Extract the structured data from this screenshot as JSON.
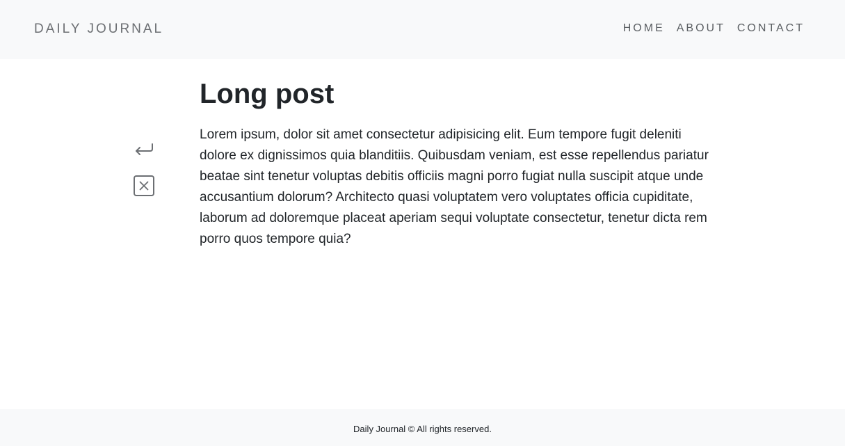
{
  "navbar": {
    "brand": "DAILY JOURNAL",
    "links": [
      {
        "label": "HOME"
      },
      {
        "label": "ABOUT"
      },
      {
        "label": "CONTACT"
      }
    ]
  },
  "post": {
    "title": "Long post",
    "body": "Lorem ipsum, dolor sit amet consectetur adipisicing elit. Eum tempore fugit deleniti dolore ex dignissimos quia blanditiis. Quibusdam veniam, est esse repellendus pariatur beatae sint tenetur voluptas debitis officiis magni porro fugiat nulla suscipit atque unde accusantium dolorum? Architecto quasi voluptatem vero voluptates officia cupiditate, laborum ad doloremque placeat aperiam sequi voluptate consectetur, tenetur dicta rem porro quos tempore quia?"
  },
  "actions": {
    "back_icon": "return-arrow-icon",
    "delete_icon": "close-box-icon"
  },
  "footer": {
    "text": "Daily Journal © All rights reserved."
  }
}
